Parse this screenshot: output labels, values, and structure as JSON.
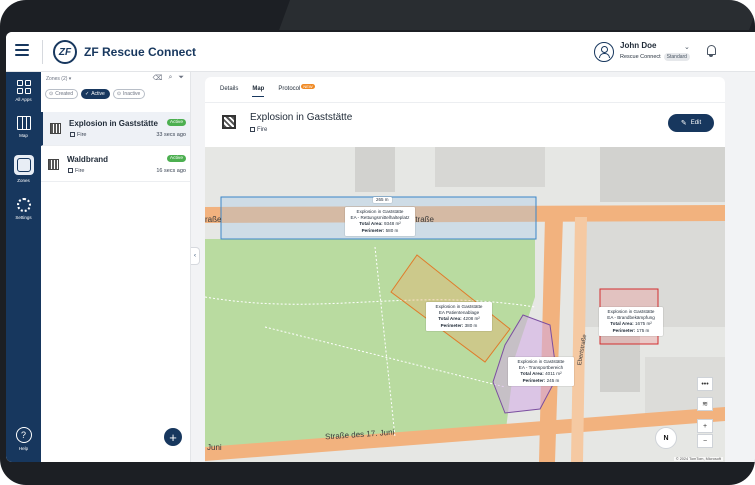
{
  "header": {
    "app_title": "ZF Rescue Connect",
    "logo_text": "ZF",
    "user_name": "John Doe",
    "user_org": "Rescue Connect",
    "user_plan": "Standard"
  },
  "rail": {
    "items": [
      {
        "label": "All Apps",
        "icon": "grid-icon"
      },
      {
        "label": "Map",
        "icon": "map-icon"
      },
      {
        "label": "Zones",
        "icon": "zones-icon",
        "active": true
      },
      {
        "label": "Settings",
        "icon": "gear-icon"
      }
    ],
    "help_label": "Help"
  },
  "list": {
    "dropdown": "Zones (2) ▾",
    "filters": [
      {
        "label": "Created",
        "active": false
      },
      {
        "label": "Active",
        "active": true
      },
      {
        "label": "Inactive",
        "active": false
      }
    ],
    "zones": [
      {
        "name": "Explosion in Gaststätte",
        "type": "Fire",
        "status": "Active",
        "time": "33 secs ago",
        "selected": true
      },
      {
        "name": "Waldbrand",
        "type": "Fire",
        "status": "Active",
        "time": "16 secs ago",
        "selected": false
      }
    ]
  },
  "detail": {
    "tabs": [
      {
        "label": "Details",
        "active": false
      },
      {
        "label": "Map",
        "active": true
      },
      {
        "label": "Protocol",
        "active": false,
        "badge": "NEW"
      }
    ],
    "title": "Explosion in Gaststätte",
    "type": "Fire",
    "edit_label": "Edit"
  },
  "map": {
    "streets": {
      "top": "Straße",
      "top_left": "raße",
      "bottom": "Straße des 17. Juni",
      "bottom_left": "Juni",
      "right": "Ebertstraße"
    },
    "dimension_label": "265 m",
    "zones": [
      {
        "title": "Explosion in Gaststätte",
        "subtitle": "EA - Rettungsmittelhalteplatz",
        "area_label": "Total Area:",
        "area": "9348 m²",
        "perimeter_label": "Perimeter:",
        "perimeter": "580 m"
      },
      {
        "title": "Explosion in Gaststätte",
        "subtitle": "EA Patientenablage",
        "area_label": "Total Area:",
        "area": "4208 m²",
        "perimeter_label": "Perimeter:",
        "perimeter": "380 m"
      },
      {
        "title": "Explosion in Gaststätte",
        "subtitle": "EA - Transportbereich",
        "area_label": "Total Area:",
        "area": "4011 m²",
        "perimeter_label": "Perimeter:",
        "perimeter": "245 m"
      },
      {
        "title": "Explosion in Gaststätte",
        "subtitle": "EA - Brandbekämpfung",
        "area_label": "Total Area:",
        "area": "1675 m²",
        "perimeter_label": "Perimeter:",
        "perimeter": "175 m"
      }
    ],
    "controls": {
      "more": "•••",
      "layers": "≋",
      "zoom_in": "+",
      "zoom_out": "−",
      "compass": "N"
    },
    "attribution": "© 2024 TomTom, Microsoft"
  },
  "colors": {
    "primary": "#17375e",
    "active_green": "#4caf50",
    "park_green": "#b9dba0",
    "road_orange": "#f2b27e",
    "zone_blue": "#3a86c8",
    "zone_orange": "#e07b2a",
    "zone_purple": "#7b4fa0",
    "zone_red": "#d32f2f"
  }
}
